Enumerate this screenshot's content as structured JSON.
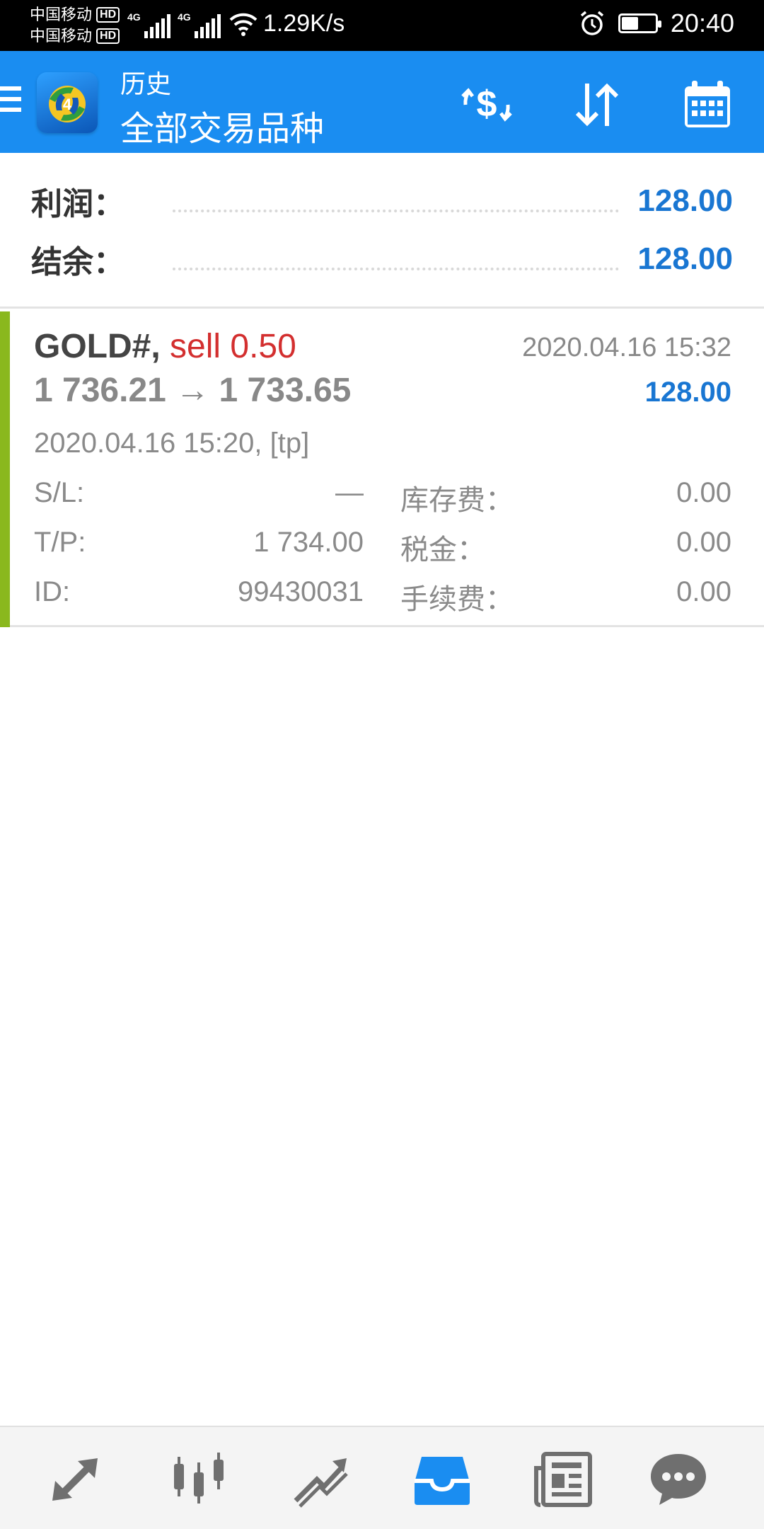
{
  "status_bar": {
    "carrier_1": "中国移动",
    "carrier_2": "中国移动",
    "hd_badge": "HD",
    "network_tag": "4G",
    "net_speed": "1.29K/s",
    "time": "20:40",
    "battery_level": 0.5
  },
  "app_bar": {
    "subtitle": "历史",
    "title": "全部交易品种",
    "actions": [
      "dollar-exchange-icon",
      "sort-icon",
      "calendar-icon"
    ]
  },
  "summary": {
    "profit_label": "利润：",
    "profit_value": "128.00",
    "balance_label": "结余：",
    "balance_value": "128.00"
  },
  "trade": {
    "symbol": "GOLD#,",
    "side": "sell 0.50",
    "close_time": "2020.04.16 15:32",
    "prices": "1 736.21 → 1 733.65",
    "profit": "128.00",
    "open_info": "2020.04.16 15:20, [tp]",
    "sl_label": "S/L:",
    "sl_value": "—",
    "tp_label": "T/P:",
    "tp_value": "1 734.00",
    "id_label": "ID:",
    "id_value": "99430031",
    "swap_label": "库存费：",
    "swap_value": "0.00",
    "tax_label": "税金：",
    "tax_value": "0.00",
    "commission_label": "手续费：",
    "commission_value": "0.00",
    "accent_color": "#8ab81e"
  },
  "bottom_nav": {
    "items": [
      "quotes-icon",
      "chart-icon",
      "trade-icon",
      "history-icon",
      "news-icon",
      "chat-icon"
    ],
    "active": "history-icon",
    "active_color": "#1a8df1",
    "inactive_color": "#6f6f6f"
  },
  "colors": {
    "app_bar": "#1a8df1",
    "profit_blue": "#1976d2",
    "sell_red": "#d32f2f"
  }
}
